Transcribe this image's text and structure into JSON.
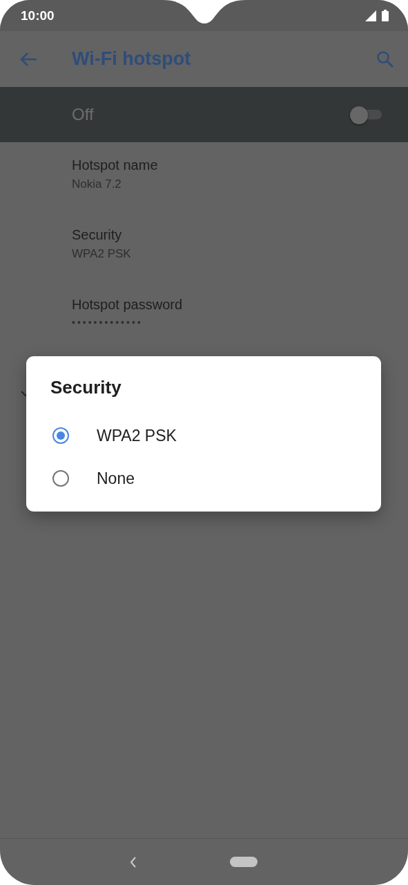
{
  "status_bar": {
    "time": "10:00"
  },
  "app_bar": {
    "title": "Wi-Fi hotspot"
  },
  "master_switch": {
    "label": "Off",
    "on": false
  },
  "settings": [
    {
      "title": "Hotspot name",
      "value": "Nokia 7.2",
      "kind": "text"
    },
    {
      "title": "Security",
      "value": "WPA2 PSK",
      "kind": "text"
    },
    {
      "title": "Hotspot password",
      "value": "•••••••••••••",
      "kind": "password"
    }
  ],
  "dialog": {
    "title": "Security",
    "options": [
      {
        "label": "WPA2 PSK",
        "selected": true
      },
      {
        "label": "None",
        "selected": false
      }
    ]
  }
}
